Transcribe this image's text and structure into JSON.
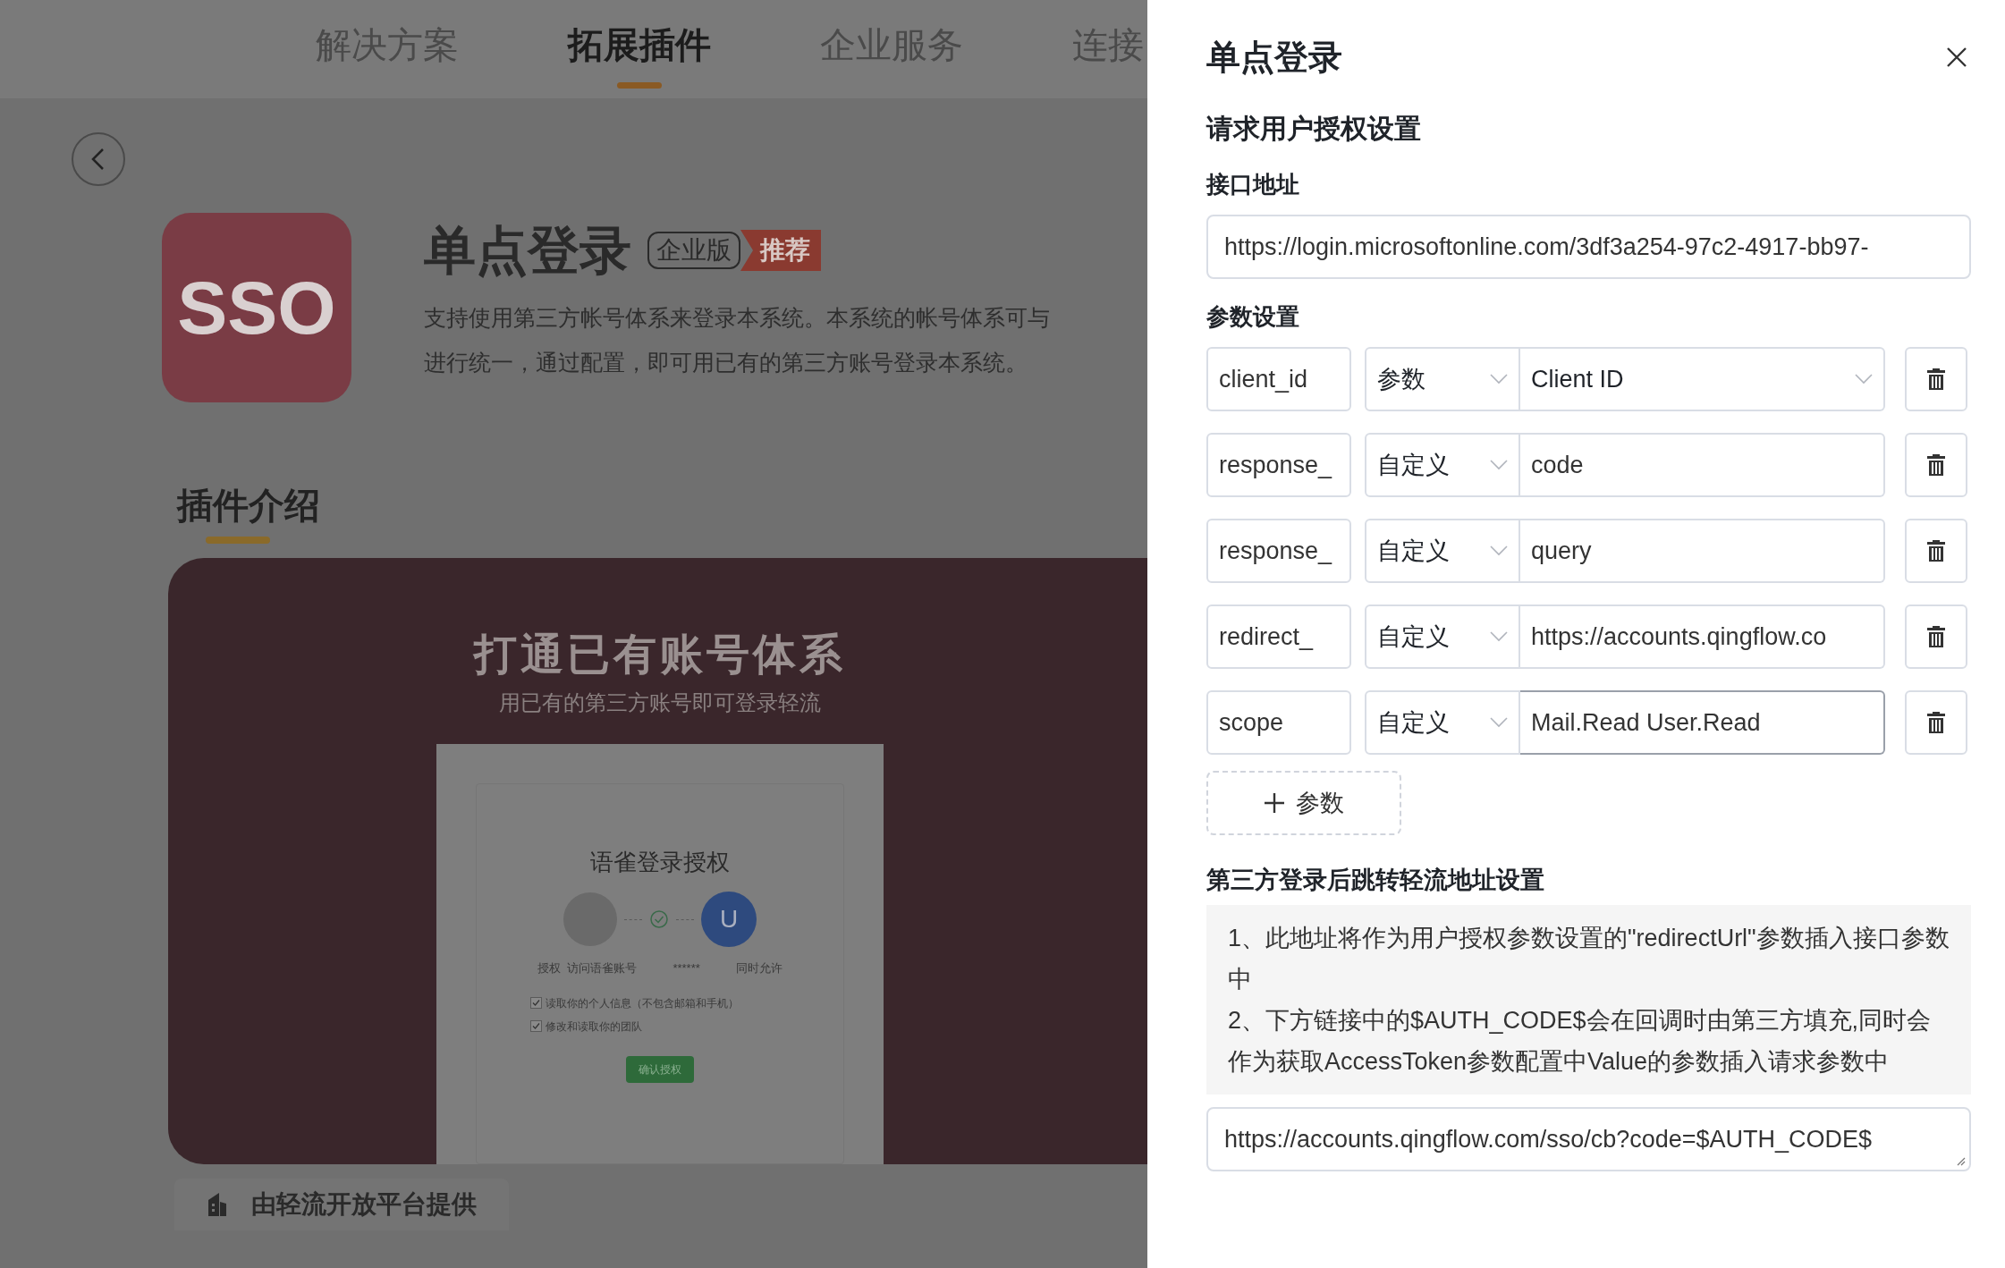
{
  "nav": {
    "tabs": [
      {
        "label": "解决方案",
        "selected": false
      },
      {
        "label": "拓展插件",
        "selected": true
      },
      {
        "label": "企业服务",
        "selected": false
      },
      {
        "label": "连接",
        "selected": false
      }
    ]
  },
  "plugin": {
    "icon_text": "SSO",
    "title": "单点登录",
    "edition_badge": "企业版",
    "recommend_tag": "推荐",
    "description": [
      "支持使用第三方帐号体系来登录本系统。本系统的帐号体系可与",
      "进行统一，通过配置，即可用已有的第三方账号登录本系统。"
    ]
  },
  "intro": {
    "heading": "插件介绍",
    "banner": {
      "title": "打通已有账号体系",
      "subtitle": "用已有的第三方账号即可登录轻流",
      "mock": {
        "title": "语雀登录授权",
        "avatar_letter": "U",
        "labels": [
          "授权  访问语雀账号",
          "******",
          "同时允许"
        ],
        "permissions": [
          {
            "label": "读取你的个人信息（不包含邮箱和手机）",
            "checked": true
          },
          {
            "label": "修改和读取你的团队",
            "checked": true
          }
        ],
        "confirm_button": "确认授权"
      }
    }
  },
  "provider": "由轻流开放平台提供",
  "drawer": {
    "title": "单点登录",
    "section": "请求用户授权设置",
    "endpoint_label": "接口地址",
    "endpoint_value": "https://login.microsoftonline.com/3df3a254-97c2-4917-bb97-",
    "params_label": "参数设置",
    "params": [
      {
        "name": "client_id",
        "type": "参数",
        "kind": "select",
        "value": "Client ID",
        "focused": false
      },
      {
        "name": "response_",
        "type": "自定义",
        "kind": "input",
        "value": "code",
        "focused": false
      },
      {
        "name": "response_",
        "type": "自定义",
        "kind": "input",
        "value": "query",
        "focused": false
      },
      {
        "name": "redirect_",
        "type": "自定义",
        "kind": "input",
        "value": "https://accounts.qingflow.co",
        "focused": false
      },
      {
        "name": "scope",
        "type": "自定义",
        "kind": "input",
        "value": "Mail.Read User.Read",
        "focused": true
      }
    ],
    "add_param": "参数",
    "redirect_section": "第三方登录后跳转轻流地址设置",
    "notes": [
      "1、此地址将作为用户授权参数设置的\"redirectUrl\"参数插入接口参数中",
      "2、下方链接中的$AUTH_CODE$会在回调时由第三方填充,同时会作为获取AccessToken参数配置中Value的参数插入请求参数中"
    ],
    "redirect_value": "https://accounts.qingflow.com/sso/cb?code=$AUTH_CODE$"
  }
}
